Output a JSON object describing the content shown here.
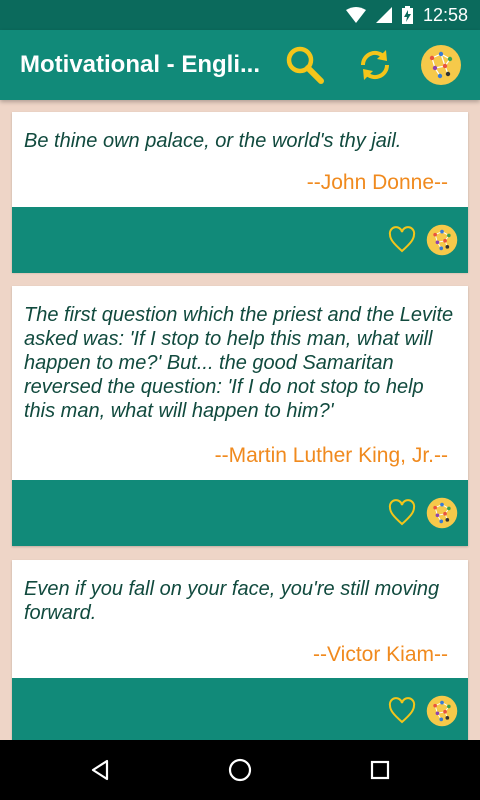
{
  "status": {
    "time": "12:58"
  },
  "app": {
    "title": "Motivational - Engli...",
    "actions": [
      {
        "name": "search-button",
        "icon": "magnifier-icon"
      },
      {
        "name": "refresh-button",
        "icon": "refresh-icon"
      },
      {
        "name": "share-app-button",
        "icon": "network-circle-icon"
      }
    ]
  },
  "quotes": [
    {
      "text": "Be thine own palace, or the world's thy jail.",
      "author": "--John Donne--"
    },
    {
      "text": "The first question which the priest and the Levite asked was: 'If I stop to help this man, what will happen to me?' But... the good Samaritan reversed the question: 'If I do not stop to help this man, what will happen to him?'",
      "author": "--Martin Luther King, Jr.--"
    },
    {
      "text": "Even if you fall on your face, you're still moving forward.",
      "author": "--Victor Kiam--"
    }
  ],
  "colors": {
    "primary": "#118A79",
    "primary_dark": "#0B6A5C",
    "accent": "#F08A1E",
    "quote_text": "#114A3E",
    "background": "#EED5C7"
  }
}
